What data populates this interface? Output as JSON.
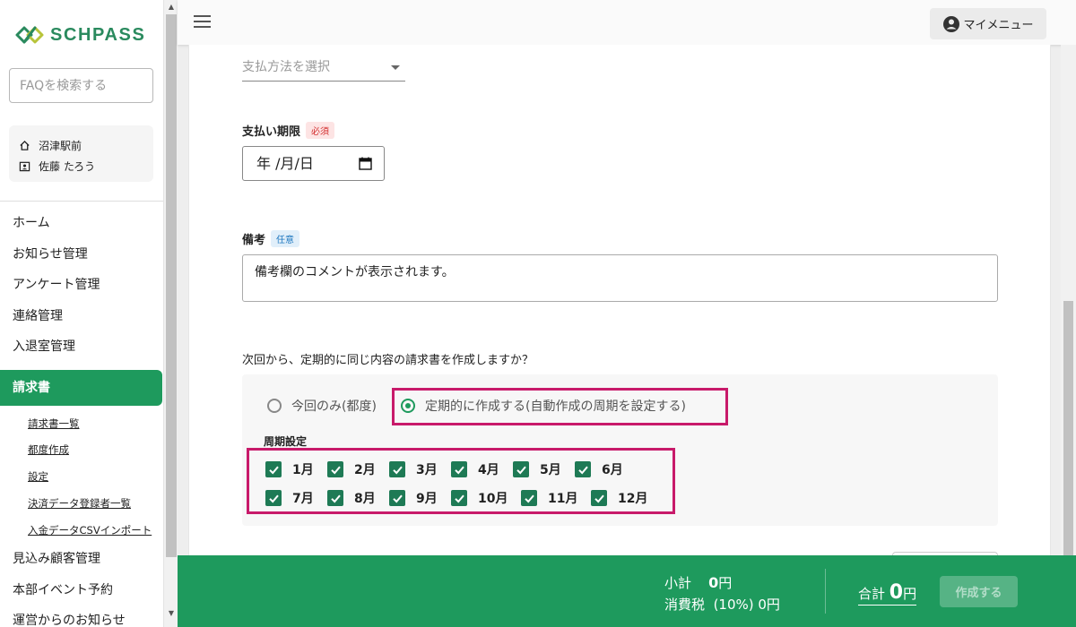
{
  "brand": {
    "name": "SCHPASS",
    "color": "#2a8a5e"
  },
  "faq_search": {
    "placeholder": "FAQを検索する"
  },
  "school": {
    "location": "沼津駅前",
    "user": "佐藤 たろう"
  },
  "nav": {
    "items_top": [
      "ホーム",
      "お知らせ管理",
      "アンケート管理",
      "連絡管理",
      "入退室管理"
    ],
    "active": "請求書",
    "sub_items": [
      "請求書一覧",
      "都度作成",
      "設定",
      "決済データ登録者一覧",
      "入金データCSVインポート"
    ],
    "items_bottom": [
      "見込み顧客管理",
      "本部イベント予約",
      "運営からのお知らせ"
    ]
  },
  "header": {
    "my_menu": "マイメニュー"
  },
  "form": {
    "payment_method_placeholder": "支払方法を選択",
    "due_date_label": "支払い期限",
    "required_badge": "必須",
    "due_date_value": "年 /月/日",
    "notes_label": "備考",
    "optional_badge": "任意",
    "notes_value": "備考欄のコメントが表示されます。",
    "recurring_question": "次回から、定期的に同じ内容の請求書を作成しますか？",
    "option_once": "今回のみ(都度)",
    "option_recurring": "定期的に作成する(自動作成の周期を設定する)",
    "selected_option": "option_recurring",
    "cycle_label": "周期設定",
    "months_row1": [
      "1月",
      "2月",
      "3月",
      "4月",
      "5月",
      "6月"
    ],
    "months_row2": [
      "7月",
      "8月",
      "9月",
      "10月",
      "11月",
      "12月"
    ],
    "months_checked": true
  },
  "footer": {
    "subtotal_label": "小計",
    "subtotal_value": "0",
    "yen": "円",
    "tax_label": "消費税",
    "tax_rate": "(10%)",
    "tax_value": "0円",
    "total_label": "合計",
    "total_value": "0",
    "create_button": "作成する"
  },
  "colors": {
    "accent": "#1e9a5d",
    "highlight": "#c81a6a"
  }
}
